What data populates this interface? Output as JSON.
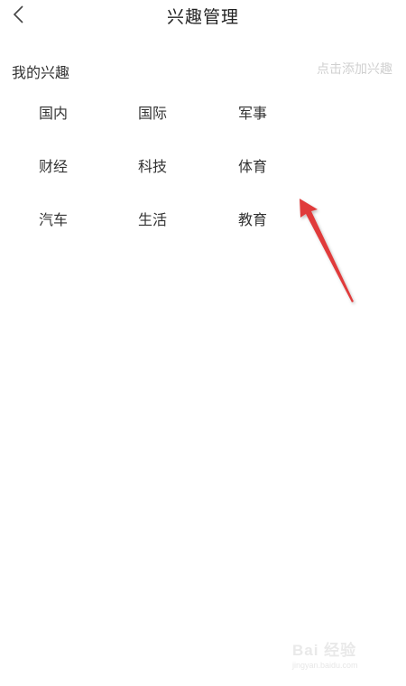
{
  "header": {
    "title": "兴趣管理",
    "back_icon": "chevron-left-icon"
  },
  "section": {
    "title": "我的兴趣",
    "add_hint": "点击添加兴趣"
  },
  "interests": [
    {
      "label": "国内"
    },
    {
      "label": "国际"
    },
    {
      "label": "军事"
    },
    {
      "label": "财经"
    },
    {
      "label": "科技"
    },
    {
      "label": "体育"
    },
    {
      "label": "汽车"
    },
    {
      "label": "生活"
    },
    {
      "label": "教育"
    }
  ],
  "annotation": {
    "arrow_color": "#e03a3a"
  },
  "watermark": {
    "logo": "Bai 经验",
    "url": "jingyan.baidu.com"
  }
}
